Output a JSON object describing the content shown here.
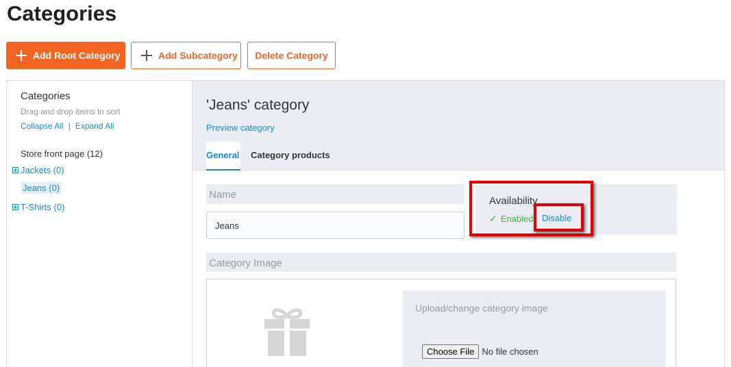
{
  "page": {
    "title": "Categories"
  },
  "toolbar": {
    "add_root_label": "Add Root Category",
    "add_sub_label": "Add Subcategory",
    "delete_label": "Delete Category"
  },
  "sidebar": {
    "title": "Categories",
    "hint": "Drag and drop items to sort",
    "collapse_all": "Collapse All",
    "separator": "|",
    "expand_all": "Expand All",
    "root_label": "Store front page (12)",
    "items": [
      {
        "label": "Jackets (0)",
        "expandable": true,
        "selected": false
      },
      {
        "label": "Jeans (0)",
        "expandable": false,
        "selected": true
      },
      {
        "label": "T-Shirts (0)",
        "expandable": true,
        "selected": false
      }
    ]
  },
  "category": {
    "title": "'Jeans' category",
    "preview_link": "Preview category",
    "tabs": [
      {
        "label": "General",
        "active": true
      },
      {
        "label": "Category products",
        "active": false
      }
    ],
    "name_label": "Name",
    "name_value": "Jeans",
    "availability": {
      "title": "Availability",
      "status_icon": "check-icon",
      "status": "Enabled",
      "action": "Disable"
    },
    "image_label": "Category Image",
    "placeholder_icon": "gift-icon",
    "upload": {
      "title": "Upload/change category image",
      "choose_file": "Choose File",
      "file_status": "No file chosen"
    }
  },
  "colors": {
    "accent": "#f26522",
    "link": "#1a8ad0",
    "enabled": "#3cb34a",
    "highlight": "#e10000",
    "panel_bg": "#ebedf2"
  }
}
